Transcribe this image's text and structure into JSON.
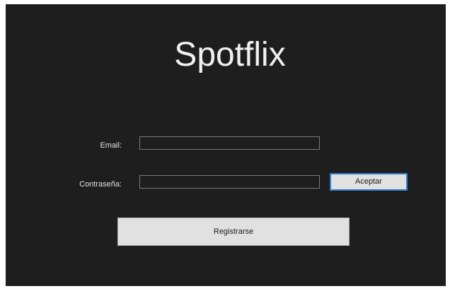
{
  "app": {
    "title": "Spotflix"
  },
  "form": {
    "email_label": "Email:",
    "email_value": "",
    "password_label": "Contraseña:",
    "password_value": "",
    "accept_label": "Aceptar",
    "register_label": "Registrarse"
  },
  "colors": {
    "background": "#1e1e1e",
    "title_text": "#f0f0f0",
    "button_face": "#e1e1e1",
    "focus_border": "#2e7fd8"
  }
}
